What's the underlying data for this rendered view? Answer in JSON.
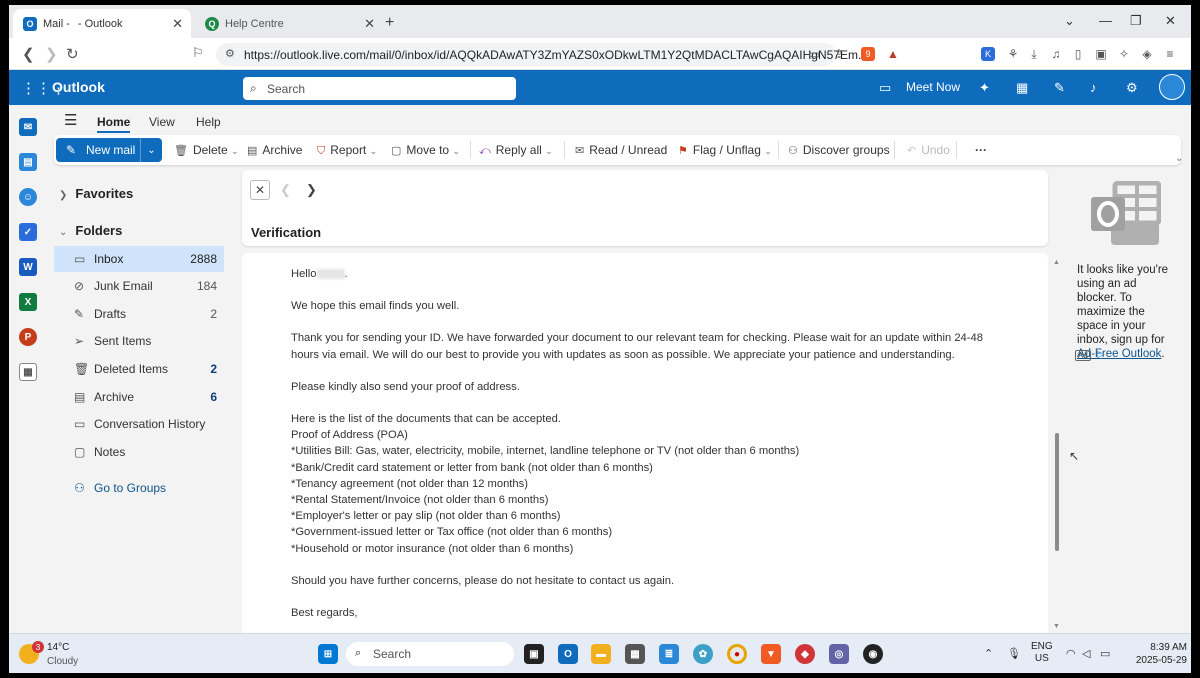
{
  "browser": {
    "tabs": [
      {
        "title": "Mail - ",
        "title_tail": "- Outlook",
        "icon": "outlook-icon"
      },
      {
        "title": "Help Centre",
        "icon": "helpcentre-icon"
      }
    ],
    "new_tab": "+",
    "url": "https://outlook.live.com/mail/0/inbox/id/AQQkADAwATY3ZmYAZS0xODkwLTM1Y2QtMDACLTAwCgAQAIHgN57Em...",
    "extension_badge": "9"
  },
  "outlook": {
    "brand": "Outlook",
    "search_placeholder": "Search",
    "meet_now": "Meet Now",
    "accent_color": "#0f6cbd"
  },
  "ribbon": {
    "tabs": [
      "Home",
      "View",
      "Help"
    ],
    "selected_tab": "Home",
    "new_mail": "New mail",
    "delete": "Delete",
    "archive": "Archive",
    "report": "Report",
    "move_to": "Move to",
    "reply_all": "Reply all",
    "read_unread": "Read / Unread",
    "flag_unflag": "Flag / Unflag",
    "discover_groups": "Discover groups",
    "undo": "Undo",
    "more": "···"
  },
  "folders": {
    "favorites": "Favorites",
    "folders_label": "Folders",
    "items": [
      {
        "label": "Inbox",
        "count": "2888",
        "icon": "inbox-icon"
      },
      {
        "label": "Junk Email",
        "count": "184",
        "icon": "junk-icon"
      },
      {
        "label": "Drafts",
        "count": "2",
        "icon": "drafts-icon"
      },
      {
        "label": "Sent Items",
        "count": "",
        "icon": "sent-icon"
      },
      {
        "label": "Deleted Items",
        "count": "2",
        "icon": "trash-icon"
      },
      {
        "label": "Archive",
        "count": "6",
        "icon": "archive-icon"
      },
      {
        "label": "Conversation History",
        "count": "",
        "icon": "folder-icon"
      },
      {
        "label": "Notes",
        "count": "",
        "icon": "notes-icon"
      }
    ],
    "go_to_groups": "Go to Groups"
  },
  "message": {
    "subject": "Verification",
    "greeting": "Hello",
    "p1": "We hope this email finds you well.",
    "p2": "Thank you for sending your ID. We have forwarded your document to our relevant team for checking. Please wait for an update within 24-48 hours via email. We will do our best to provide you with updates as soon as possible. We appreciate your patience and understanding.",
    "p3": "Please kindly also send your proof of address.",
    "list_intro": "Here is the list of the documents that can be accepted.",
    "list_title": "Proof of Address (POA)",
    "list": [
      "*Utilities Bill: Gas, water, electricity, mobile, internet, landline telephone or TV (not older than 6 months)",
      "*Bank/Credit card statement or letter from bank (not older than 6 months)",
      "*Tenancy agreement (not older than 12 months)",
      "*Rental Statement/Invoice (not older than 6 months)",
      "*Employer's letter or pay slip (not older than 6 months)",
      "*Government-issued letter or Tax office (not older than 6 months)",
      "*Household or motor insurance (not older than 6 months)"
    ],
    "p4": "Should you have further concerns, please do not hesitate to contact us again.",
    "signoff": "Best regards,"
  },
  "ad": {
    "text": "It looks like you're using an ad blocker. To maximize the space in your inbox, sign up for",
    "link": "Ad-Free Outlook",
    "period": ".",
    "badge": "Ad"
  },
  "taskbar": {
    "weather_temp": "14°C",
    "weather_cond": "Cloudy",
    "weather_badge": "3",
    "search": "Search",
    "lang_top": "ENG",
    "lang_bottom": "US",
    "time": "8:39 AM",
    "date": "2025-05-29"
  }
}
